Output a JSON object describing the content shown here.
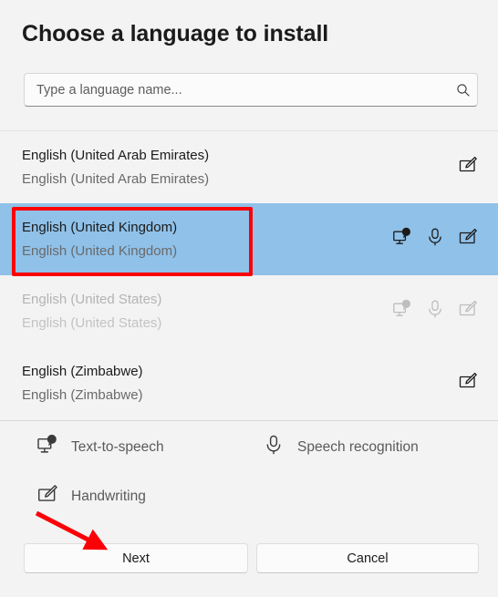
{
  "dialog": {
    "title": "Choose a language to install"
  },
  "search": {
    "placeholder": "Type a language name...",
    "value": "",
    "icon": "search-icon"
  },
  "list": {
    "rows": [
      {
        "primary": "English (United Arab Emirates)",
        "secondary": "English (United Arab Emirates)",
        "state": "normal",
        "icons": [
          "handwriting-icon"
        ]
      },
      {
        "primary": "English (United Kingdom)",
        "secondary": "English (United Kingdom)",
        "state": "selected",
        "icons": [
          "text-to-speech-icon",
          "speech-recognition-icon",
          "handwriting-icon"
        ]
      },
      {
        "primary": "English (United States)",
        "secondary": "English (United States)",
        "state": "disabled",
        "icons": [
          "text-to-speech-icon",
          "speech-recognition-icon",
          "handwriting-icon"
        ]
      },
      {
        "primary": "English (Zimbabwe)",
        "secondary": "English (Zimbabwe)",
        "state": "normal",
        "icons": [
          "handwriting-icon"
        ]
      }
    ]
  },
  "legend": {
    "text_to_speech": "Text-to-speech",
    "speech_recognition": "Speech recognition",
    "handwriting": "Handwriting"
  },
  "footer": {
    "next_label": "Next",
    "cancel_label": "Cancel"
  },
  "annotations": {
    "highlight_color": "#fb0007",
    "selection_color": "#8fc1e9"
  }
}
